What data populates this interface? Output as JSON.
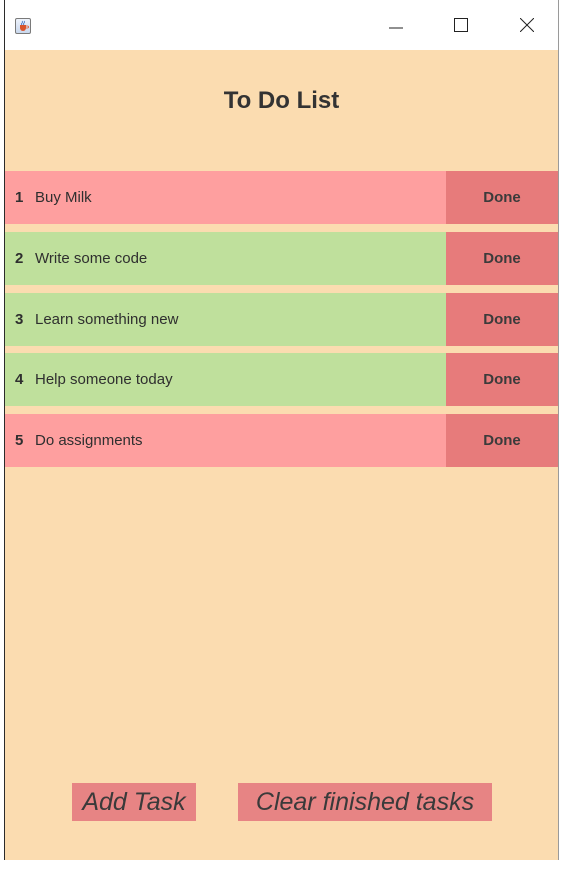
{
  "window": {
    "app_icon": "java-coffee-icon",
    "controls": {
      "minimize_icon": "minimize-icon",
      "maximize_icon": "maximize-icon",
      "close_icon": "close-icon"
    }
  },
  "heading": "To Do List",
  "tasks": [
    {
      "number": "1",
      "text": "Buy Milk",
      "done_label": "Done",
      "color": "#fe9f9f"
    },
    {
      "number": "2",
      "text": "Write some code",
      "done_label": "Done",
      "color": "#bfe09c"
    },
    {
      "number": "3",
      "text": "Learn something new",
      "done_label": "Done",
      "color": "#bfe09c"
    },
    {
      "number": "4",
      "text": "Help someone today",
      "done_label": "Done",
      "color": "#bfe09c"
    },
    {
      "number": "5",
      "text": "Do assignments",
      "done_label": "Done",
      "color": "#fe9f9f"
    }
  ],
  "actions": {
    "add_task": "Add Task",
    "clear_finished": "Clear finished tasks"
  },
  "colors": {
    "background": "#fbdcb0",
    "done_button": "#e77b7b",
    "pending_task": "#fe9f9f",
    "finished_task": "#bfe09c",
    "action_button": "#e78484"
  }
}
